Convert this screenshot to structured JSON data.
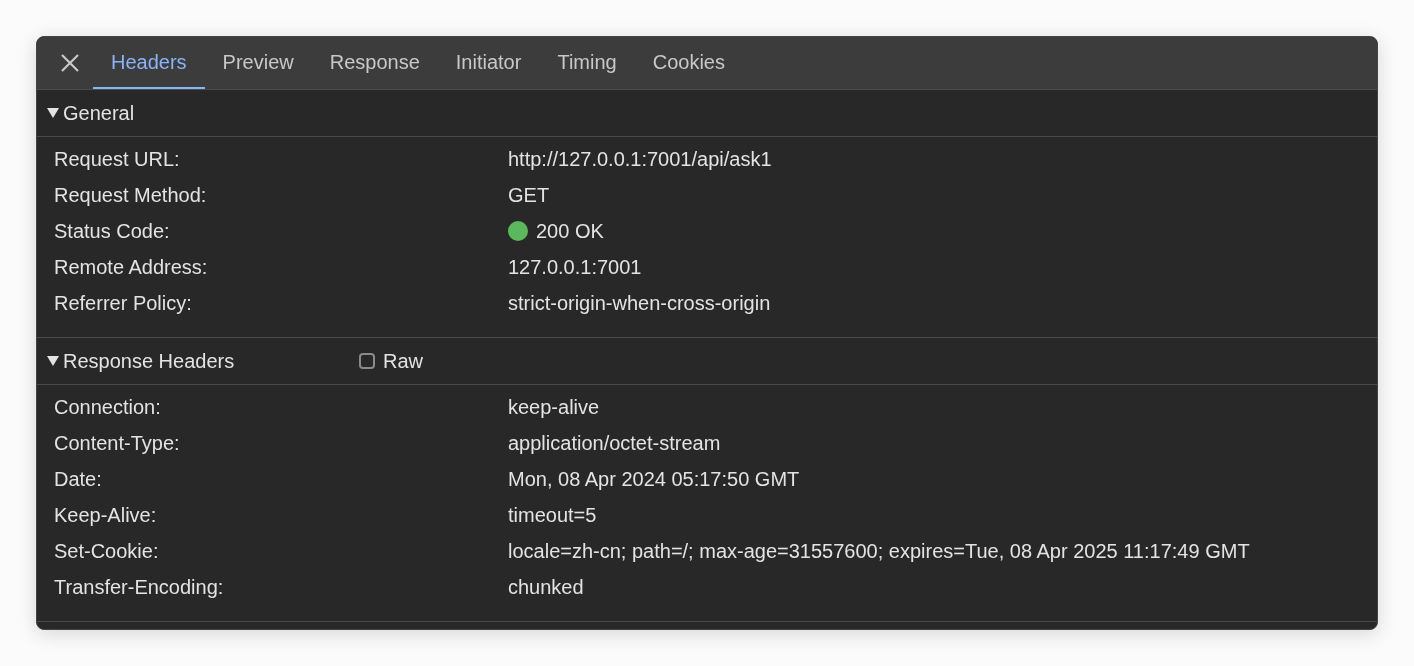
{
  "tabs": [
    {
      "label": "Headers",
      "selected": true
    },
    {
      "label": "Preview",
      "selected": false
    },
    {
      "label": "Response",
      "selected": false
    },
    {
      "label": "Initiator",
      "selected": false
    },
    {
      "label": "Timing",
      "selected": false
    },
    {
      "label": "Cookies",
      "selected": false
    }
  ],
  "sections": [
    {
      "title": "General",
      "expanded": true,
      "rows": [
        {
          "name": "Request URL:",
          "value": "http://127.0.0.1:7001/api/ask1"
        },
        {
          "name": "Request Method:",
          "value": "GET"
        },
        {
          "name": "Status Code:",
          "value": "200 OK",
          "color": "#5cb85c"
        },
        {
          "name": "Remote Address:",
          "value": "127.0.0.1:7001"
        },
        {
          "name": "Referrer Policy:",
          "value": "strict-origin-when-cross-origin"
        }
      ]
    },
    {
      "title": "Response Headers",
      "expanded": true,
      "raw": {
        "label": "Raw",
        "checked": false
      },
      "rows": [
        {
          "name": "Connection:",
          "value": "keep-alive"
        },
        {
          "name": "Content-Type:",
          "value": "application/octet-stream"
        },
        {
          "name": "Date:",
          "value": "Mon, 08 Apr 2024 05:17:50 GMT"
        },
        {
          "name": "Keep-Alive:",
          "value": "timeout=5"
        },
        {
          "name": "Set-Cookie:",
          "value": "locale=zh-cn; path=/; max-age=31557600; expires=Tue, 08 Apr 2025 11:17:49 GMT"
        },
        {
          "name": "Transfer-Encoding:",
          "value": "chunked"
        }
      ]
    }
  ]
}
